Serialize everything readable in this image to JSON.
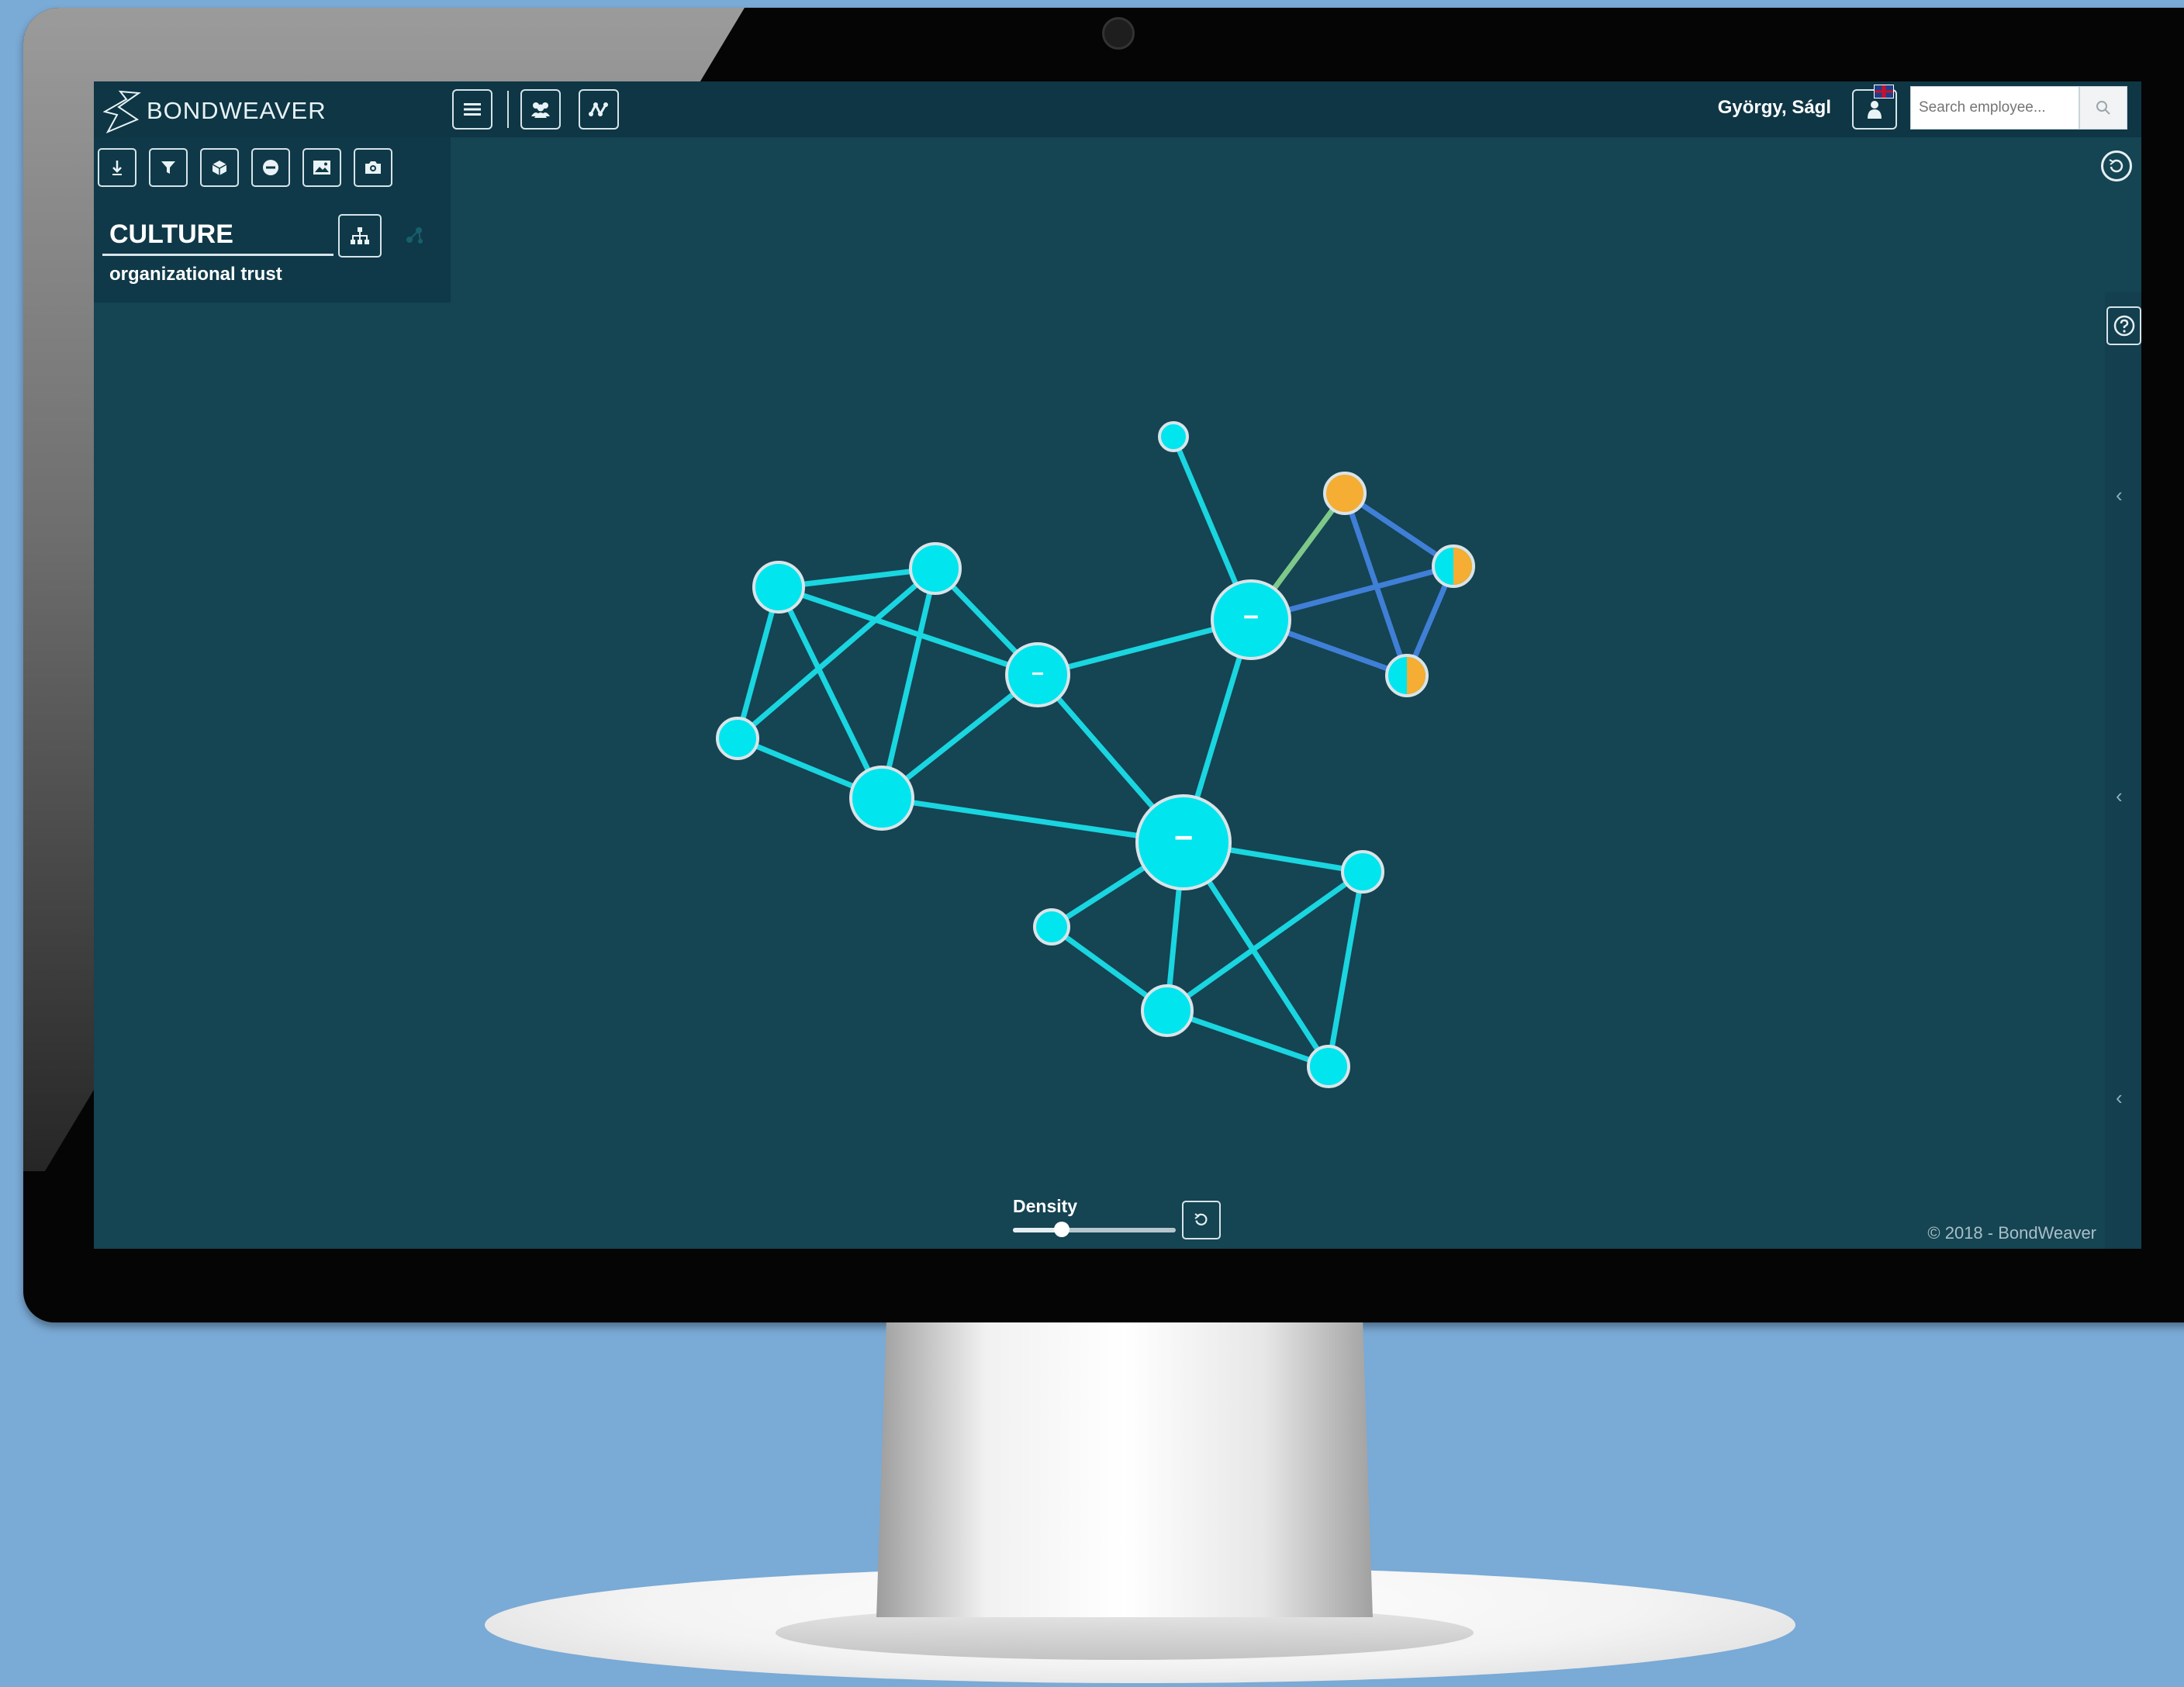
{
  "app": {
    "logo_text": "BONDWEAVER"
  },
  "toolbar": {
    "menu_icon": "hamburger-icon",
    "team_icon": "team-icon",
    "network_icon": "network-icon"
  },
  "user": {
    "name": "György, Ságl",
    "avatar_icon": "user-icon",
    "language_flag": "uk-flag-icon"
  },
  "search": {
    "placeholder": "Search employee...",
    "value": ""
  },
  "tools": [
    {
      "icon": "export-icon"
    },
    {
      "icon": "filter-icon"
    },
    {
      "icon": "cube-icon"
    },
    {
      "icon": "minus-circle-icon"
    },
    {
      "icon": "image-icon"
    },
    {
      "icon": "camera-icon"
    }
  ],
  "panel": {
    "title": "CULTURE",
    "subtitle": "organizational trust"
  },
  "density": {
    "label": "Density",
    "level": 0.3
  },
  "footer": {
    "copyright": "© 2018 - BondWeaver"
  },
  "colors": {
    "screen_bg": "#154453",
    "node": "#00e5ee",
    "edge": "#19d6e0",
    "edge_blue": "#3f7fd6",
    "edge_green": "#7ec98a",
    "node_orange": "#f5ad33"
  },
  "graph": {
    "nodes": [
      {
        "id": "n1",
        "label": ""
      },
      {
        "id": "n2",
        "label": ""
      },
      {
        "id": "n3",
        "label": ""
      },
      {
        "id": "n4",
        "label": ""
      },
      {
        "id": "n5",
        "label": "−"
      },
      {
        "id": "n6",
        "label": "−"
      },
      {
        "id": "n7",
        "label": "−"
      },
      {
        "id": "n8",
        "label": ""
      },
      {
        "id": "n9",
        "label": ""
      },
      {
        "id": "n10",
        "label": ""
      },
      {
        "id": "n11",
        "label": ""
      },
      {
        "id": "n12",
        "label": ""
      },
      {
        "id": "n13",
        "label": ""
      },
      {
        "id": "n14",
        "label": ""
      },
      {
        "id": "n15",
        "label": ""
      }
    ]
  }
}
